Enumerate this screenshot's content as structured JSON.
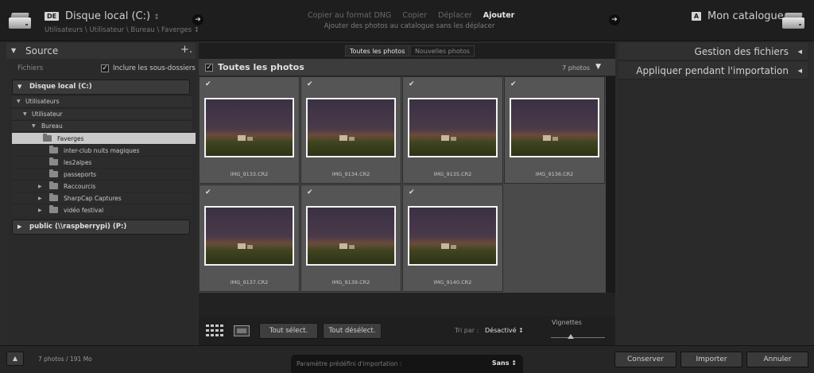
{
  "source": {
    "tag": "DE",
    "title": "Disque local (C:)",
    "title_chevron": "↕",
    "path": "Utilisateurs \\ Utilisateur \\ Bureau \\ Faverges ↕"
  },
  "modes": {
    "items": [
      "Copier au format DNG",
      "Copier",
      "Déplacer",
      "Ajouter"
    ],
    "active_index": 3,
    "description": "Ajouter des photos au catalogue sans les déplacer"
  },
  "catalog": {
    "tag": "A",
    "title": "Mon catalogue"
  },
  "arrow_glyph": "➜",
  "left_panel": {
    "title": "Source",
    "add_glyph": "+.",
    "fichiers_label": "Fichiers",
    "include_subfolders_label": "Inclure les sous-dossiers",
    "include_subfolders_checked": true,
    "drive_c": "Disque local (C:)",
    "tree": {
      "utilisateurs": "Utilisateurs",
      "utilisateur": "Utilisateur",
      "bureau": "Bureau"
    },
    "folders": [
      {
        "name": "Faverges",
        "selected": true,
        "expandable": false
      },
      {
        "name": "inter-club nuits magiques",
        "selected": false,
        "expandable": false
      },
      {
        "name": "les2alpes",
        "selected": false,
        "expandable": false
      },
      {
        "name": "passeports",
        "selected": false,
        "expandable": false
      },
      {
        "name": "Raccourcis",
        "selected": false,
        "expandable": true
      },
      {
        "name": "SharpCap Captures",
        "selected": false,
        "expandable": true
      },
      {
        "name": "vidéo festival",
        "selected": false,
        "expandable": true
      }
    ],
    "drive_p": "public (\\\\raspberrypi) (P:)"
  },
  "center": {
    "tabs": [
      "Toutes les photos",
      "Nouvelles photos"
    ],
    "active_tab": 0,
    "grid_title": "Toutes les photos",
    "photo_count": "7 photos",
    "photos": [
      {
        "name": "IMG_9133.CR2",
        "checked": true
      },
      {
        "name": "IMG_9134.CR2",
        "checked": true
      },
      {
        "name": "IMG_9135.CR2",
        "checked": true
      },
      {
        "name": "IMG_9136.CR2",
        "checked": true
      },
      {
        "name": "IMG_9137.CR2",
        "checked": true
      },
      {
        "name": "IMG_9139.CR2",
        "checked": true
      },
      {
        "name": "IMG_9140.CR2",
        "checked": true
      }
    ],
    "select_all": "Tout sélect.",
    "deselect_all": "Tout désélect.",
    "sort_label": "Tri par :",
    "sort_value": "Désactivé ↕",
    "thumbnails_label": "Vignettes"
  },
  "right_panel": {
    "sections": [
      "Gestion des fichiers",
      "Appliquer pendant l'importation"
    ]
  },
  "footer": {
    "info": "7 photos / 191 Mo",
    "preset_label": "Paramètre prédéfini d'importation :",
    "preset_value": "Sans ↕",
    "buttons": [
      "Conserver",
      "Importer",
      "Annuler"
    ]
  }
}
